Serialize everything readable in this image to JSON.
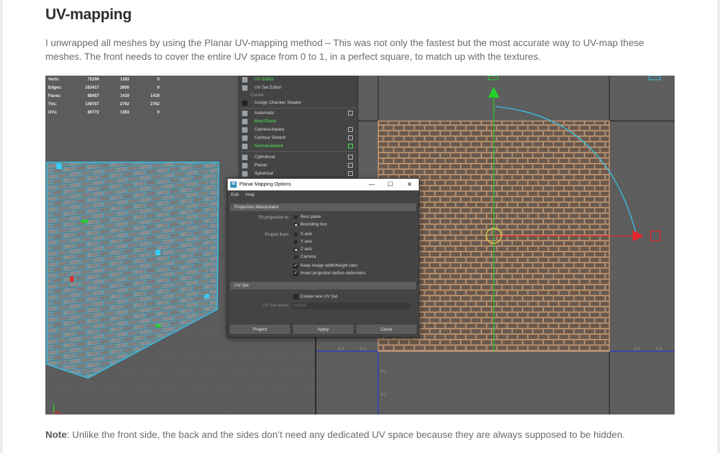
{
  "article": {
    "title": "UV-mapping",
    "paragraph": "I unwrapped all meshes by using the Planar UV-mapping method – This was not only the fastest but the most accurate way to UV-map these meshes. The front needs to cover the entire UV space from 0 to 1, in a perfect square, to match up with the textures.",
    "note_label": "Note",
    "note_text": ": Unlike the front side, the back and the sides don’t need any dedicated UV space because they are always supposed to be hidden."
  },
  "hud": {
    "rows": [
      {
        "k": "Verts:",
        "a": "75296",
        "b": "1383",
        "c": "0"
      },
      {
        "k": "Edges:",
        "a": "163417",
        "b": "2800",
        "c": "0"
      },
      {
        "k": "Faces:",
        "a": "88457",
        "b": "1419",
        "c": "1419"
      },
      {
        "k": "Tris:",
        "a": "149707",
        "b": "2762",
        "c": "2762"
      },
      {
        "k": "UVs:",
        "a": "80772",
        "b": "1383",
        "c": "0"
      }
    ]
  },
  "menu": {
    "uv_editor": "UV Editor",
    "uv_set_editor": "UV Set Editor",
    "create": "Create",
    "assign_checker": "Assign Checker Shader",
    "automatic": "Automatic",
    "best_plane": "Best Plane",
    "camera_based": "Camera-based",
    "contour_stretch": "Contour Stretch",
    "normal_based": "Normal-Based",
    "cylindrical": "Cylindrical",
    "planar": "Planar",
    "spherical": "Spherical"
  },
  "dialog": {
    "title": "Planar Mapping Options",
    "menu_edit": "Edit",
    "menu_help": "Help",
    "minimize": "—",
    "maximize": "☐",
    "close": "✕",
    "section_projection": "Projection Manipulator",
    "fit_label": "Fit projection to:",
    "fit_best": "Best plane",
    "fit_bbox": "Bounding box",
    "project_from_label": "Project from:",
    "axis_x": "X axis",
    "axis_y": "Y axis",
    "axis_z": "Z axis",
    "axis_camera": "Camera",
    "keep_ratio": "Keep image width/height ratio",
    "insert_projection": "Insert projection before deformers",
    "section_uvset": "UV Set",
    "create_uvset": "Create new UV Set",
    "uvset_name_label": "UV Set name:",
    "uvset_name_value": "uvSet1",
    "btn_project": "Project",
    "btn_apply": "Apply",
    "btn_close": "Close"
  },
  "uv_axis": {
    "t1": "-0.2",
    "t2": "-0.1",
    "t3": "1.1",
    "t4": "1.2",
    "t5": "-0.1",
    "t6": "-0.2"
  },
  "colors": {
    "uv_orange": "#d7a57c",
    "wire_cyan": "#35c6ef",
    "axis_red": "#e8262a",
    "axis_green": "#22d22a",
    "axis_blue": "#2a3fd8"
  }
}
